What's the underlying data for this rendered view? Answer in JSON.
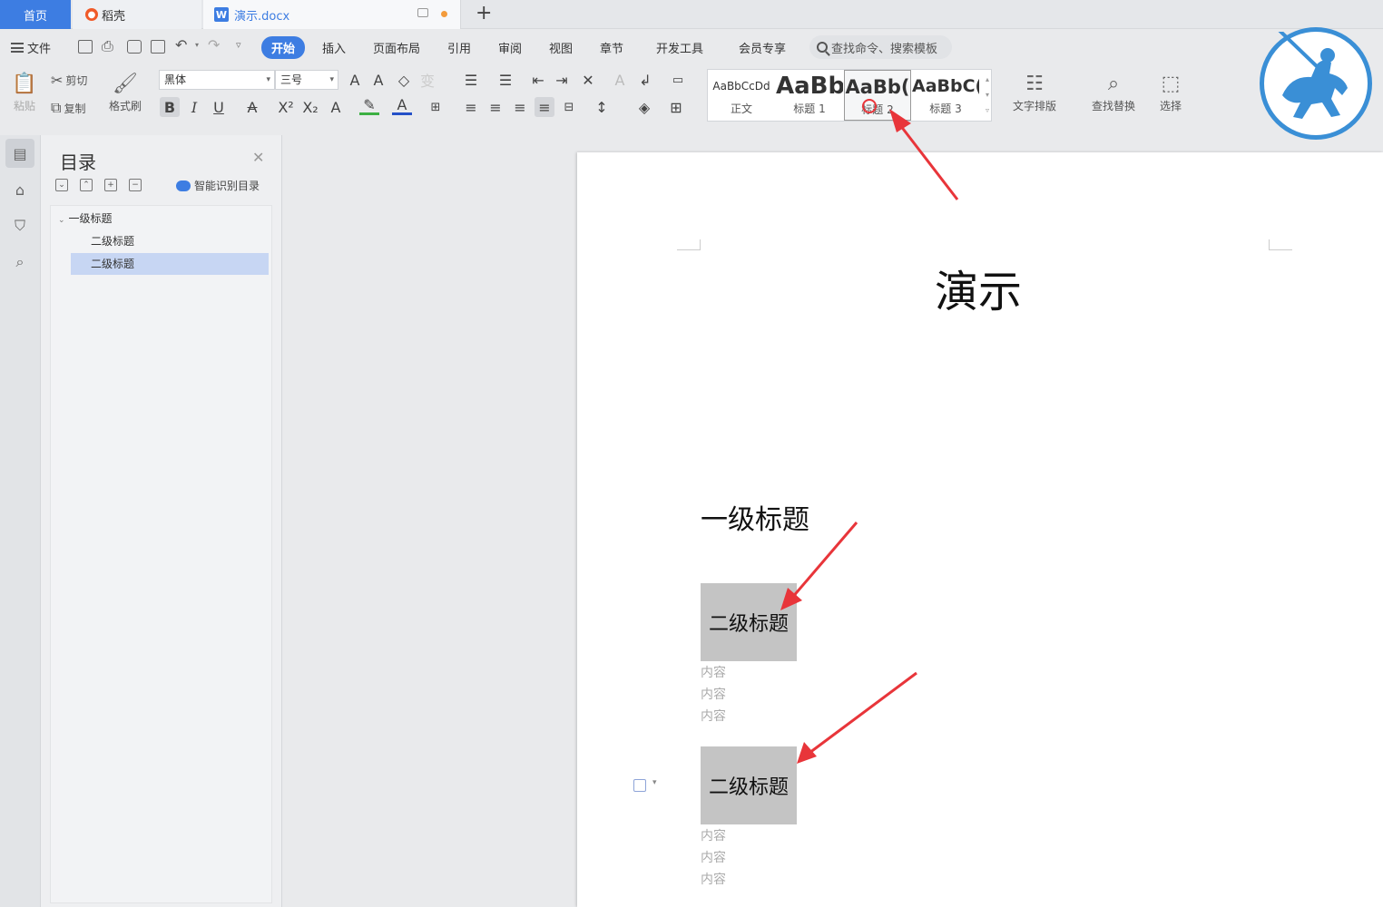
{
  "tabs": {
    "home": "首页",
    "daoke": "稻壳",
    "doc": "演示.docx"
  },
  "menu": {
    "file": "文件",
    "items": [
      "开始",
      "插入",
      "页面布局",
      "引用",
      "审阅",
      "视图",
      "章节",
      "开发工具",
      "会员专享"
    ],
    "active": "开始",
    "search_placeholder": "查找命令、搜索模板"
  },
  "ribbon": {
    "paste": "粘贴",
    "cut": "剪切",
    "copy": "复制",
    "format_painter": "格式刷",
    "font_name": "黑体",
    "font_size": "三号",
    "styles": [
      {
        "sample": "AaBbCcDd",
        "label": "正文"
      },
      {
        "sample": "AaBb",
        "label": "标题 1"
      },
      {
        "sample": "AaBb(",
        "label": "标题 2"
      },
      {
        "sample": "AaBbC(",
        "label": "标题 3"
      }
    ],
    "text_layout": "文字排版",
    "find_replace": "查找替换",
    "select": "选择"
  },
  "toc": {
    "title": "目录",
    "smart_toc": "智能识别目录",
    "items": [
      {
        "label": "一级标题",
        "level": 1,
        "selected": false
      },
      {
        "label": "二级标题",
        "level": 2,
        "selected": false
      },
      {
        "label": "二级标题",
        "level": 2,
        "selected": true
      }
    ]
  },
  "document": {
    "title": "演示",
    "heading1": "一级标题",
    "sections": [
      {
        "heading": "二级标题",
        "lines": [
          "内容",
          "内容",
          "内容"
        ]
      },
      {
        "heading": "二级标题",
        "lines": [
          "内容",
          "内容",
          "内容"
        ]
      }
    ]
  },
  "colors": {
    "accent": "#3d7de2",
    "annotation_arrow": "#e8353a",
    "heading_highlight": "#c4c4c4",
    "toc_selected": "#c7d6f3"
  }
}
